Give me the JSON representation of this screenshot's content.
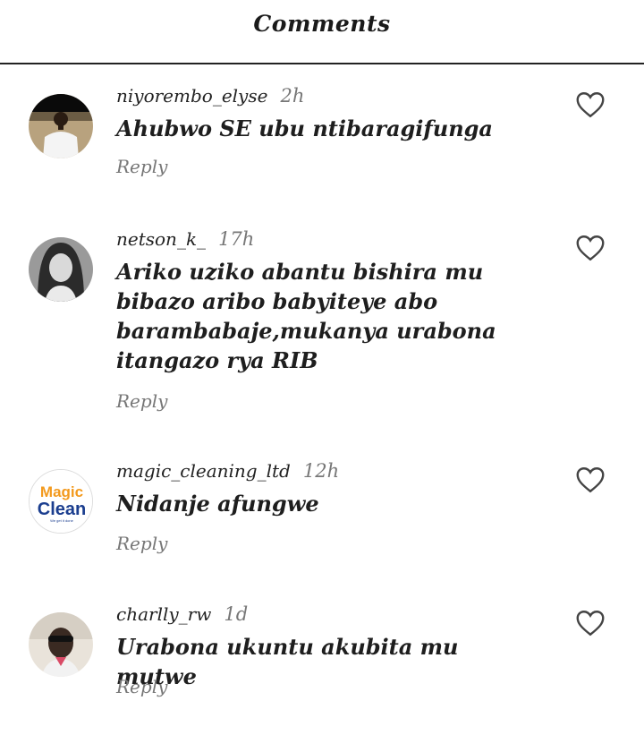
{
  "header": {
    "title": "Comments"
  },
  "comments": [
    {
      "username": "niyorembo_elyse",
      "time": "2h",
      "text": "Ahubwo SE ubu ntibaragifunga",
      "reply_label": "Reply",
      "like_icon": "heart-outline-icon"
    },
    {
      "username": "netson_k_",
      "time": "17h",
      "text": "Ariko uziko abantu bishira mu bibazo aribo babyiteye abo barambabaje,mukanya urabona itangazo rya RIB",
      "reply_label": "Reply",
      "like_icon": "heart-outline-icon"
    },
    {
      "username": "magic_cleaning_ltd",
      "time": "12h",
      "text": "Nidanje afungwe",
      "reply_label": "Reply",
      "like_icon": "heart-outline-icon",
      "avatar_logo": {
        "line1": "Magic",
        "line2": "Clean",
        "tagline": "We get it done"
      }
    },
    {
      "username": "charlly_rw",
      "time": "1d",
      "text": "Urabona ukuntu akubita mu mutwe",
      "reply_label": "Reply",
      "like_icon": "heart-outline-icon"
    }
  ],
  "colors": {
    "text": "#1e1e1e",
    "muted": "#777777",
    "divider": "#222222",
    "logo_orange": "#f39a1e",
    "logo_blue": "#1b3e8f"
  }
}
